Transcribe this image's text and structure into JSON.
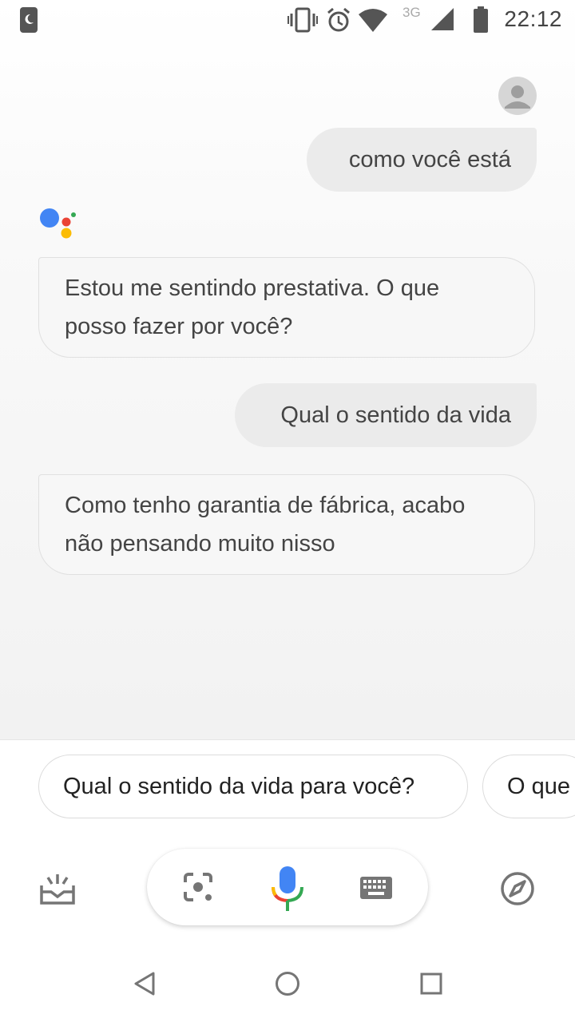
{
  "status_bar": {
    "time": "22:12",
    "network_type": "3G",
    "icons": [
      "notification-icon",
      "vibrate-icon",
      "alarm-icon",
      "wifi-icon",
      "signal-icon",
      "battery-icon"
    ]
  },
  "conversation": {
    "messages": [
      {
        "role": "user",
        "text": "como você está"
      },
      {
        "role": "assistant",
        "text_lines": [
          "Estou me sentindo prestativa. O que",
          "posso fazer por você?"
        ]
      },
      {
        "role": "user",
        "text": "Qual o sentido da vida"
      },
      {
        "role": "assistant",
        "text_lines": [
          "Como tenho garantia de fábrica, acabo",
          "não pensando muito nisso"
        ]
      }
    ]
  },
  "suggestions": [
    "Qual o sentido da vida para você?",
    "O que"
  ],
  "toolbar": {
    "icons": [
      "updates-icon",
      "lens-icon",
      "microphone-icon",
      "keyboard-icon",
      "explore-compass-icon"
    ]
  },
  "navigation": {
    "icons": [
      "back-icon",
      "home-icon",
      "recents-icon"
    ]
  },
  "colors": {
    "google_blue": "#4285F4",
    "google_red": "#EA4335",
    "google_yellow": "#FBBC05",
    "google_green": "#34A853",
    "icon_gray": "#757575"
  }
}
